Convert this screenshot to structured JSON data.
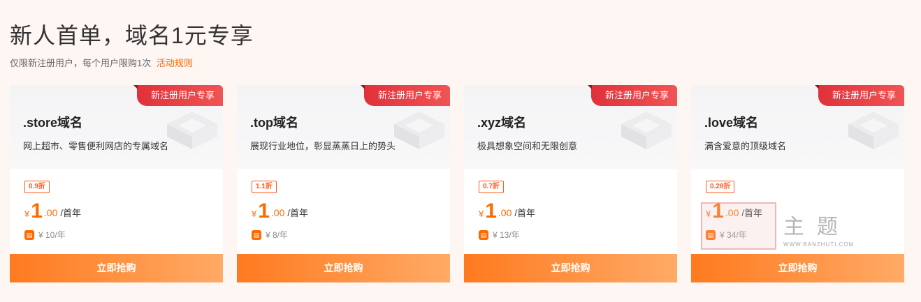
{
  "header": {
    "title": "新人首单，域名1元专享",
    "subtitle": "仅限新注册用户，每个用户限购1次",
    "rules_link": "活动规则"
  },
  "cards": [
    {
      "ribbon": "新注册用户专享",
      "name": ".store域名",
      "desc": "网上超市、零售便利网店的专属域名",
      "discount": "0.9折",
      "currency": "¥",
      "price_int": "1",
      "price_dec": ".00",
      "period": "/首年",
      "renew": "¥ 10/年",
      "buy": "立即抢购"
    },
    {
      "ribbon": "新注册用户专享",
      "name": ".top域名",
      "desc": "展现行业地位，彰显蒸蒸日上的势头",
      "discount": "1.1折",
      "currency": "¥",
      "price_int": "1",
      "price_dec": ".00",
      "period": "/首年",
      "renew": "¥ 8/年",
      "buy": "立即抢购"
    },
    {
      "ribbon": "新注册用户专享",
      "name": ".xyz域名",
      "desc": "极具想象空间和无限创意",
      "discount": "0.7折",
      "currency": "¥",
      "price_int": "1",
      "price_dec": ".00",
      "period": "/首年",
      "renew": "¥ 13/年",
      "buy": "立即抢购"
    },
    {
      "ribbon": "新注册用户专享",
      "name": ".love域名",
      "desc": "满含爱意的顶级域名",
      "discount": "0.28折",
      "currency": "¥",
      "price_int": "1",
      "price_dec": ".00",
      "period": "/首年",
      "renew": "¥ 34/年",
      "buy": "立即抢购"
    }
  ],
  "renew_icon": "store-icon",
  "watermark": {
    "text": "主题",
    "url": "WWW.BANZHUTI.COM"
  },
  "colors": {
    "accent": "#ff6a00",
    "ribbon": "#e0313b",
    "button_start": "#ff7a1f",
    "button_end": "#ffaa66"
  }
}
